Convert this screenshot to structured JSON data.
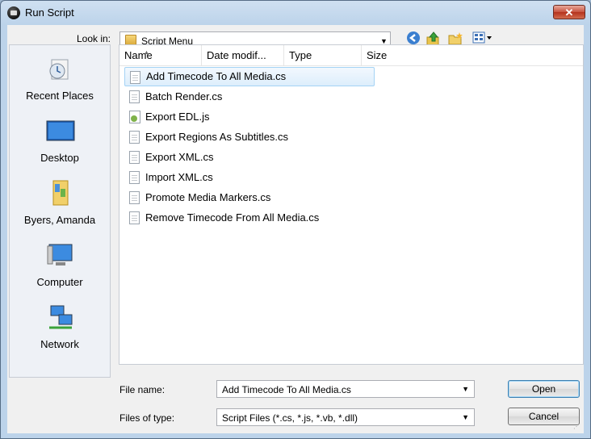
{
  "window": {
    "title": "Run Script",
    "close_glyph": "✕"
  },
  "look_in": {
    "label": "Look in:",
    "value": "Script Menu"
  },
  "toolbar": {
    "back_icon": "back-arrow",
    "up_icon": "up-folder",
    "new_folder_icon": "new-folder",
    "view_icon": "view-menu"
  },
  "places": [
    {
      "label": "Recent Places",
      "icon": "recent-places"
    },
    {
      "label": "Desktop",
      "icon": "desktop"
    },
    {
      "label": "Byers, Amanda",
      "icon": "user-folder"
    },
    {
      "label": "Computer",
      "icon": "computer"
    },
    {
      "label": "Network",
      "icon": "network"
    }
  ],
  "columns": [
    "Name",
    "Date modif...",
    "Type",
    "Size"
  ],
  "files": [
    "Add Timecode To All Media.cs",
    "Batch Render.cs",
    "Export EDL.js",
    "Export Regions As Subtitles.cs",
    "Export XML.cs",
    "Import XML.cs",
    "Promote Media Markers.cs",
    "Remove Timecode From All Media.cs"
  ],
  "file_name": {
    "label": "File name:",
    "value": "Add Timecode To All Media.cs"
  },
  "file_type": {
    "label": "Files of type:",
    "value": "Script Files (*.cs, *.js, *.vb, *.dll)"
  },
  "buttons": {
    "open": "Open",
    "cancel": "Cancel"
  },
  "colors": {
    "selection_border": "#a5d3f5",
    "title_bar": "#bcd3ea",
    "close_button": "#c7523e"
  }
}
